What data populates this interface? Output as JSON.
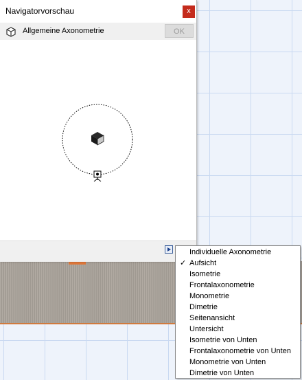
{
  "panel": {
    "title": "Navigatorvorschau",
    "close_label": "x",
    "view_name": "Allgemeine Axonometrie",
    "ok_label": "OK",
    "view_icon": "cube-outline-icon",
    "object_icon": "cube-icon",
    "camera_icon": "camera-icon"
  },
  "menu": {
    "items": [
      {
        "label": "Individuelle Axonometrie",
        "checked": false
      },
      {
        "label": "Aufsicht",
        "checked": true
      },
      {
        "label": "Isometrie",
        "checked": false
      },
      {
        "label": "Frontalaxonometrie",
        "checked": false
      },
      {
        "label": "Monometrie",
        "checked": false
      },
      {
        "label": "Dimetrie",
        "checked": false
      },
      {
        "label": "Seitenansicht",
        "checked": false
      },
      {
        "label": "Untersicht",
        "checked": false
      },
      {
        "label": "Isometrie von Unten",
        "checked": false
      },
      {
        "label": "Frontalaxonometrie von Unten",
        "checked": false
      },
      {
        "label": "Monometrie von Unten",
        "checked": false
      },
      {
        "label": "Dimetrie von Unten",
        "checked": false
      }
    ],
    "check_mark": "✓"
  },
  "colors": {
    "close": "#c42b1c",
    "grid": "#c9d9f1",
    "accent": "#e0783a"
  }
}
